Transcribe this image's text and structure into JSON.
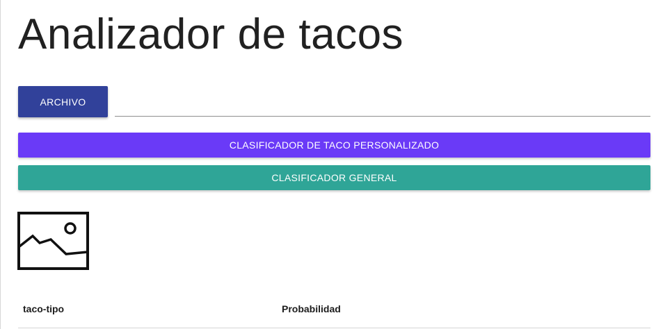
{
  "page": {
    "title": "Analizador de tacos"
  },
  "file_input": {
    "button_label": "ARCHIVO",
    "value": "",
    "button_color": "#31419a"
  },
  "actions": {
    "custom_classifier_label": "CLASIFICADOR DE TACO PERSONALIZADO",
    "custom_classifier_color": "#6a3af7",
    "general_classifier_label": "CLASIFICADOR GENERAL",
    "general_classifier_color": "#2fa597"
  },
  "preview": {
    "icon": "image-placeholder-icon"
  },
  "results_table": {
    "headers": [
      "taco-tipo",
      "Probabilidad"
    ],
    "rows": []
  }
}
